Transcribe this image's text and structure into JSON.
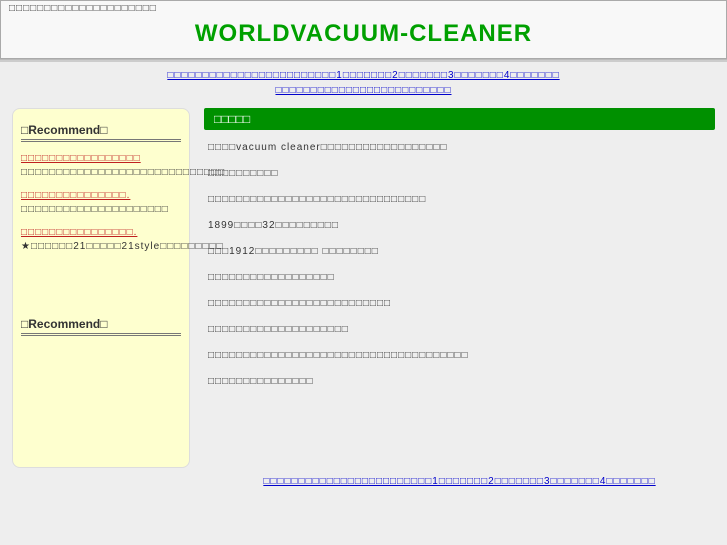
{
  "header": {
    "tiny": "□□□□□□□□□□□□□□□□□□□□□",
    "title": "WORLDVACUUM-CLEANER"
  },
  "nav": {
    "row1": "□□□□□□□□□□□□□□□□□□□□□□□□1□□□□□□□2□□□□□□□3□□□□□□□4□□□□□□□",
    "row2": "□□□□□□□□□□□□□□□□□□□□□□□□□"
  },
  "sidebar": {
    "head1": "□Recommend□",
    "items": [
      {
        "link": "□□□□□□□□□□□□□□□□□",
        "desc": "□□□□□□□□□□□□□□□□□□□□□□□□□□□□□"
      },
      {
        "link": "□□□□□□□□□□□□□□□.",
        "desc": "□□□□□□□□□□□□□□□□□□□□□"
      },
      {
        "link": "□□□□□□□□□□□□□□□□.",
        "desc": "★□□□□□□21□□□□□21style□□□□□□□□□"
      }
    ],
    "head2": "□Recommend□"
  },
  "main": {
    "bar": "□□□□□",
    "paragraphs": [
      "□□□□vacuum cleaner□□□□□□□□□□□□□□□□□□",
      "□□□□□□□□□□",
      "□□□□□□□□□□□□□□□□□□□□□□□□□□□□□□□",
      "1899□□□□32□□□□□□□□□",
      "□□□1912□□□□□□□□□ □□□□□□□□",
      "□□□□□□□□□□□□□□□□□□",
      "□□□□□□□□□□□□□□□□□□□□□□□□□□",
      "□□□□□□□□□□□□□□□□□□□□",
      "□□□□□□□□□□□□□□□□□□□□□□□□□□□□□□□□□□□□□",
      "□□□□□□□□□□□□□□□"
    ]
  },
  "bottomnav": {
    "row1": "□□□□□□□□□□□□□□□□□□□□□□□□1□□□□□□□2□□□□□□□3□□□□□□□4□□□□□□□"
  }
}
